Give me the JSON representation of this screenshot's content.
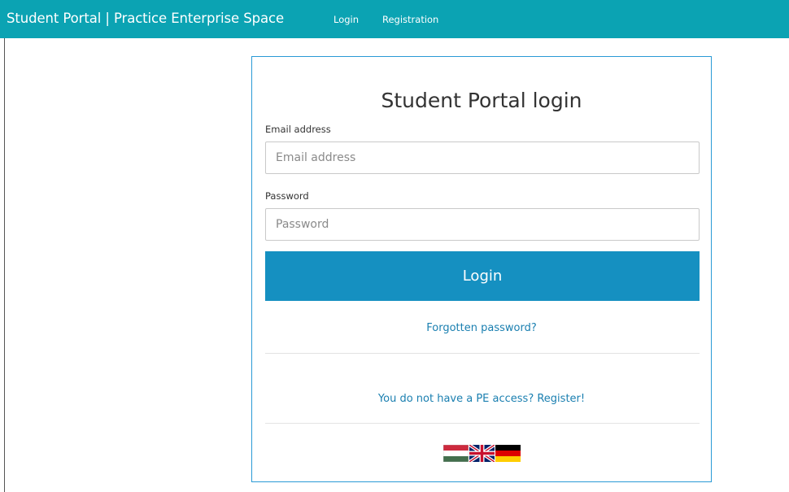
{
  "navbar": {
    "brand": "Student Portal | Practice Enterprise Space",
    "links": [
      "Login",
      "Registration"
    ],
    "color": "#0ba3b3"
  },
  "login": {
    "title": "Student Portal login",
    "email": {
      "label": "Email address",
      "placeholder": "Email address",
      "value": ""
    },
    "password": {
      "label": "Password",
      "placeholder": "Password",
      "value": ""
    },
    "submit_label": "Login",
    "forgot_link": "Forgotten password?",
    "register_link": "You do not have a PE access? Register!",
    "button_color": "#1590c1",
    "border_color": "#2a9ad6"
  },
  "languages": [
    {
      "icon": "flag-hungary-icon"
    },
    {
      "icon": "flag-uk-icon"
    },
    {
      "icon": "flag-germany-icon"
    }
  ]
}
